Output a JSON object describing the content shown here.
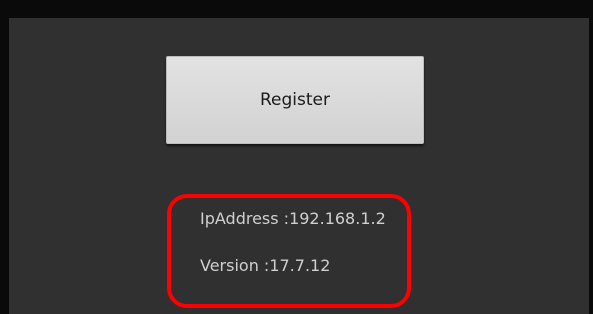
{
  "register_button": {
    "label": "Register"
  },
  "info": {
    "ip_address": "IpAddress :192.168.1.2",
    "version": "Version :17.7.12"
  },
  "colors": {
    "background": "#303030",
    "frame": "#0a0a0a",
    "button": "#dcdcdc",
    "highlight": "#ff0000"
  }
}
